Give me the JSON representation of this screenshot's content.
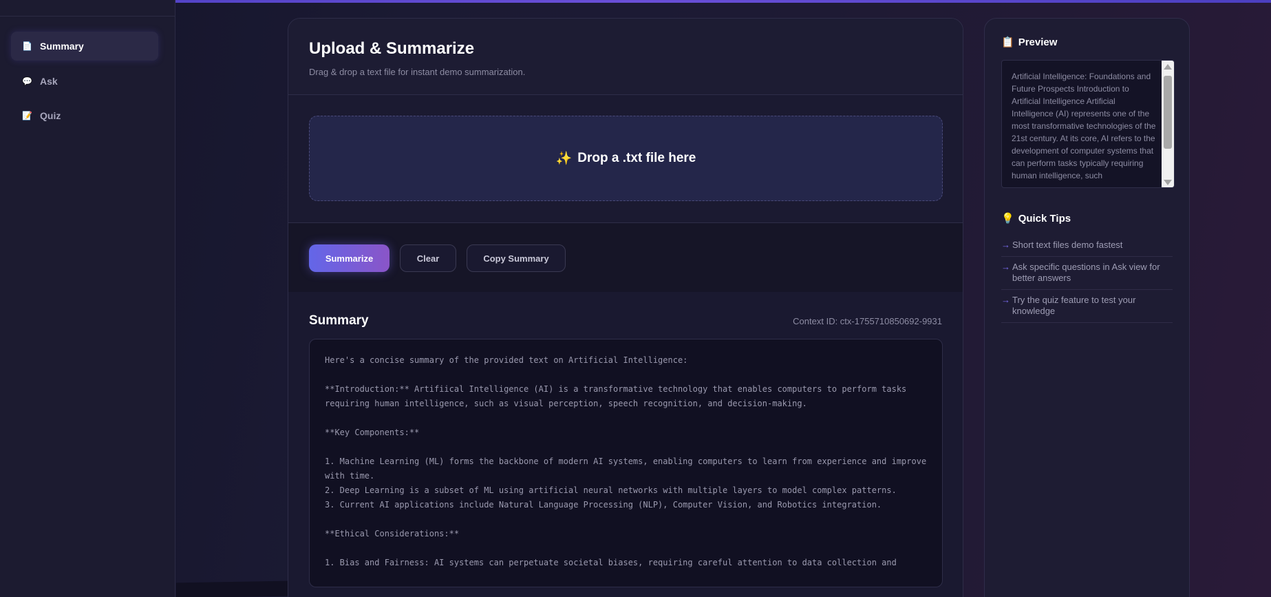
{
  "sidebar": {
    "items": [
      {
        "icon": "document-icon",
        "glyph": "📄",
        "label": "Summary",
        "active": true
      },
      {
        "icon": "speech-bubble-icon",
        "glyph": "💬",
        "label": "Ask",
        "active": false
      },
      {
        "icon": "quiz-icon",
        "glyph": "📝",
        "label": "Quiz",
        "active": false
      }
    ]
  },
  "main": {
    "title": "Upload & Summarize",
    "subtitle": "Drag & drop a text file for instant demo summarization.",
    "dropzone": {
      "icon": "sparkles-icon",
      "glyph": "✨",
      "text": "Drop a .txt file here"
    },
    "actions": {
      "summarize": "Summarize",
      "clear": "Clear",
      "copy": "Copy Summary"
    },
    "summary": {
      "title": "Summary",
      "context_id": "Context ID: ctx-1755710850692-9931",
      "lines": [
        "Here's a concise summary of the provided text on Artificial Intelligence:",
        "",
        "**Introduction:** Artifiical Intelligence (AI) is a transformative technology that enables computers to perform tasks requiring human intelligence, such as visual perception, speech recognition, and decision-making.",
        "",
        "**Key Components:**",
        "",
        "1. Machine Learning (ML) forms the backbone of modern AI systems, enabling computers to learn from experience and improve with time.",
        "2. Deep Learning is a subset of ML using artificial neural networks with multiple layers to model complex patterns.",
        "3. Current AI applications include Natural Language Processing (NLP), Computer Vision, and Robotics integration.",
        "",
        "**Ethical Considerations:**",
        "",
        "1. Bias and Fairness: AI systems can perpetuate societal biases, requiring careful attention to data collection and"
      ]
    }
  },
  "right_panel": {
    "preview": {
      "icon": "clipboard-icon",
      "glyph": "📋",
      "title": "Preview",
      "text": "Artificial Intelligence: Foundations and Future Prospects Introduction to Artificial Intelligence Artificial Intelligence (AI) represents one of the most transformative technologies of the 21st century. At its core, AI refers to the development of computer systems that can perform tasks typically requiring human intelligence, such"
    },
    "tips": {
      "icon": "lightbulb-icon",
      "glyph": "💡",
      "title": "Quick Tips",
      "arrow": "→",
      "items": [
        "Short text files demo fastest",
        "Ask specific questions in Ask view for better answers",
        "Try the quiz feature to test your knowledge"
      ]
    }
  }
}
